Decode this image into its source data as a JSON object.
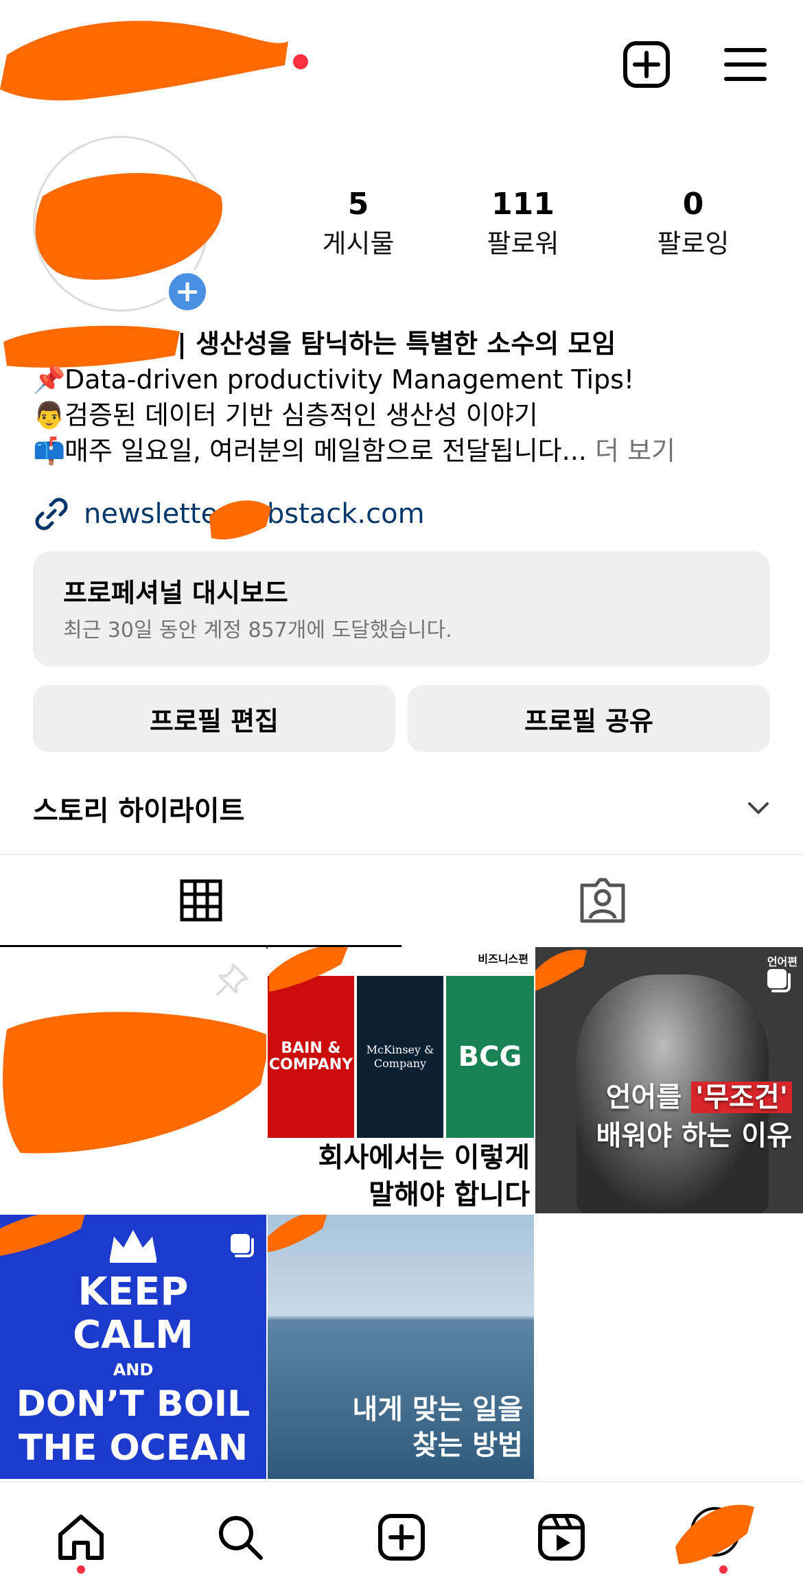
{
  "header": {
    "new_post_icon": "plus-square-icon",
    "menu_icon": "hamburger-menu-icon",
    "notification_color": "#ff3040"
  },
  "stats": [
    {
      "number": "5",
      "label": "게시물"
    },
    {
      "number": "111",
      "label": "팔로워"
    },
    {
      "number": "0",
      "label": "팔로잉"
    }
  ],
  "bio": {
    "line1": "| 생산성을 탐닉하는 특별한 소수의 모임",
    "line2": "Data-driven productivity Management Tips!",
    "line3": "검증된 데이터 기반 심층적인 생산성 이야기",
    "line4": "매주 일요일, 여러분의 메일함으로 전달됩니다...",
    "more": "더 보기",
    "link": "newslette        .substack.com"
  },
  "dashboard": {
    "title": "프로페셔널 대시보드",
    "subtitle": "최근 30일 동안 계정 857개에 도달했습니다."
  },
  "buttons": {
    "edit_profile": "프로필 편집",
    "share_profile": "프로필 공유"
  },
  "highlights": {
    "title": "스토리 하이라이트"
  },
  "tabs": [
    {
      "icon": "grid-icon",
      "active": true
    },
    {
      "icon": "tagged-person-icon",
      "active": false
    }
  ],
  "posts": {
    "post2": {
      "series": "비즈니스편",
      "logos": [
        "BAIN & COMPANY",
        "McKinsey & Company",
        "BCG"
      ],
      "caption_line1": "회사에서는 이렇게",
      "caption_line2": "말해야 합니다"
    },
    "post3": {
      "series": "언어편",
      "caption_line1_a": "언어를",
      "caption_line1_b": "'무조건'",
      "caption_line2": "배워야 하는 이유"
    },
    "post4": {
      "line1": "KEEP",
      "line2": "CALM",
      "line3": "AND",
      "line4": "DON’T BOIL",
      "line5": "THE OCEAN"
    },
    "post5": {
      "caption_line1": "내게 맞는 일을",
      "caption_line2": "찾는 방법"
    }
  },
  "bottom_nav": [
    "home-icon",
    "search-icon",
    "create-icon",
    "reels-icon",
    "profile-avatar"
  ],
  "colors": {
    "accent_link": "#00376b",
    "blue_plus": "#4a90e2",
    "redaction": "#ff6a00"
  }
}
